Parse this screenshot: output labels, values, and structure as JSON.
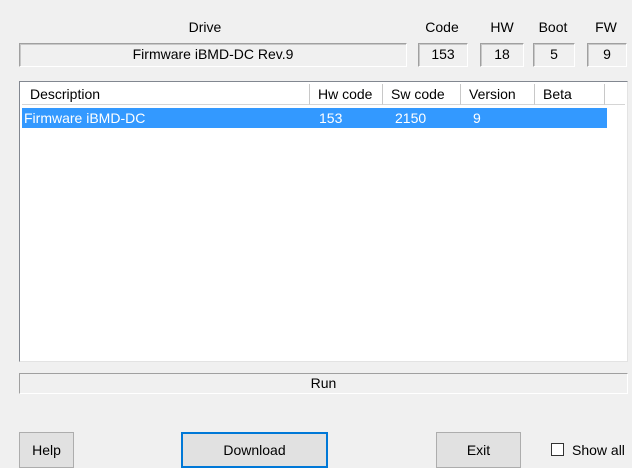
{
  "header": {
    "drive_label": "Drive",
    "code_label": "Code",
    "hw_label": "HW",
    "boot_label": "Boot",
    "fw_label": "FW"
  },
  "fields": {
    "drive_value": "Firmware iBMD-DC Rev.9",
    "code_value": "153",
    "hw_value": "18",
    "boot_value": "5",
    "fw_value": "9"
  },
  "list": {
    "columns": [
      "Description",
      "Hw code",
      "Sw code",
      "Version",
      "Beta"
    ],
    "rows": [
      {
        "description": "Firmware iBMD-DC",
        "hw_code": "153",
        "sw_code": "2150",
        "version": "9",
        "beta": "",
        "selected": true
      }
    ]
  },
  "status_text": "Run",
  "buttons": {
    "help": "Help",
    "download": "Download",
    "exit": "Exit",
    "show_all": "Show all"
  },
  "colors": {
    "selection": "#3399ff",
    "default_button_border": "#0078d7"
  }
}
